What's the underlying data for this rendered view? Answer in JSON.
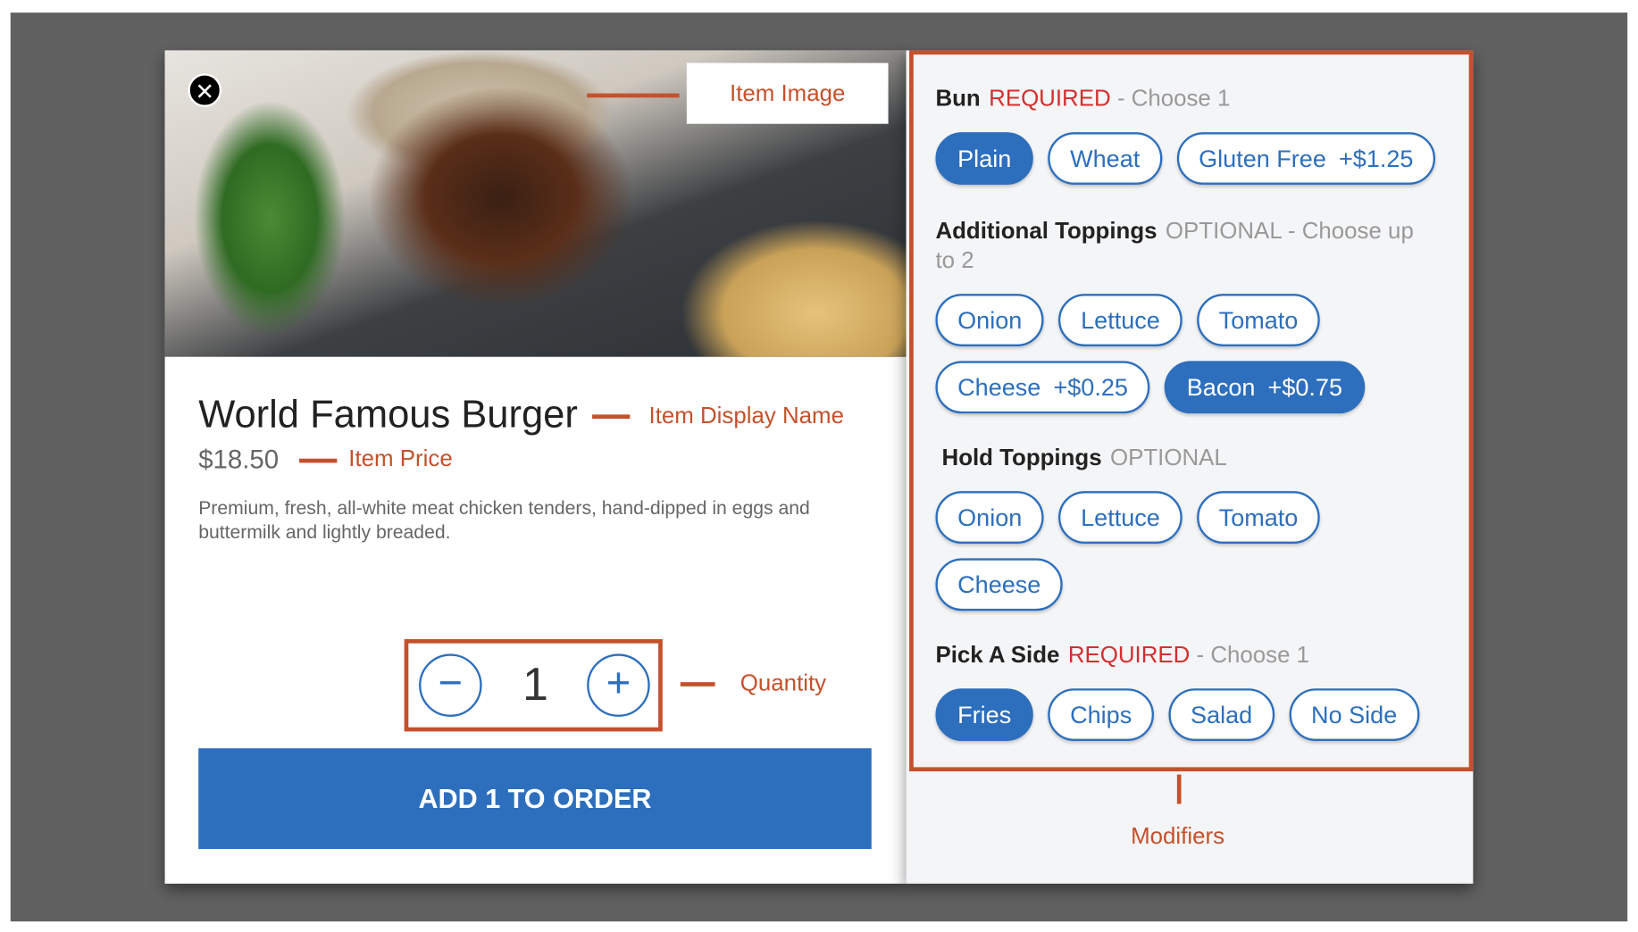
{
  "item": {
    "image_label": "Item Image",
    "name": "World Famous Burger",
    "name_annotation": "Item Display Name",
    "price": "$18.50",
    "price_annotation": "Item Price",
    "description": "Premium, fresh, all-white meat chicken tenders, hand-dipped in eggs and buttermilk and lightly breaded.",
    "close_icon": "close-icon"
  },
  "quantity": {
    "minus": "−",
    "value": "1",
    "plus": "+",
    "annotation": "Quantity"
  },
  "add_button": "ADD 1 TO ORDER",
  "modifiers_annotation": "Modifiers",
  "groups": [
    {
      "name": "Bun",
      "status": "REQUIRED",
      "rule": " - Choose 1",
      "options": [
        {
          "label": "Plain",
          "price": "",
          "selected": true
        },
        {
          "label": "Wheat",
          "price": "",
          "selected": false
        },
        {
          "label": "Gluten Free",
          "price": "+$1.25",
          "selected": false
        }
      ]
    },
    {
      "name": "Additional Toppings",
      "status": "OPTIONAL",
      "rule": " - Choose up to 2",
      "options": [
        {
          "label": "Onion",
          "price": "",
          "selected": false
        },
        {
          "label": "Lettuce",
          "price": "",
          "selected": false
        },
        {
          "label": "Tomato",
          "price": "",
          "selected": false
        },
        {
          "label": "Cheese",
          "price": "+$0.25",
          "selected": false
        },
        {
          "label": "Bacon",
          "price": "+$0.75",
          "selected": true
        }
      ]
    },
    {
      "name": "Hold Toppings",
      "status": "OPTIONAL",
      "rule": "",
      "options": [
        {
          "label": "Onion",
          "price": "",
          "selected": false
        },
        {
          "label": "Lettuce",
          "price": "",
          "selected": false
        },
        {
          "label": "Tomato",
          "price": "",
          "selected": false
        },
        {
          "label": "Cheese",
          "price": "",
          "selected": false
        }
      ]
    },
    {
      "name": "Pick A Side",
      "status": "REQUIRED",
      "rule": " - Choose 1",
      "options": [
        {
          "label": "Fries",
          "price": "",
          "selected": true
        },
        {
          "label": "Chips",
          "price": "",
          "selected": false
        },
        {
          "label": "Salad",
          "price": "",
          "selected": false
        },
        {
          "label": "No Side",
          "price": "",
          "selected": false
        }
      ]
    }
  ],
  "colors": {
    "accent": "#2d6fbd",
    "annotation": "#c4512c",
    "required": "#d32f2f",
    "backdrop": "#616161"
  }
}
